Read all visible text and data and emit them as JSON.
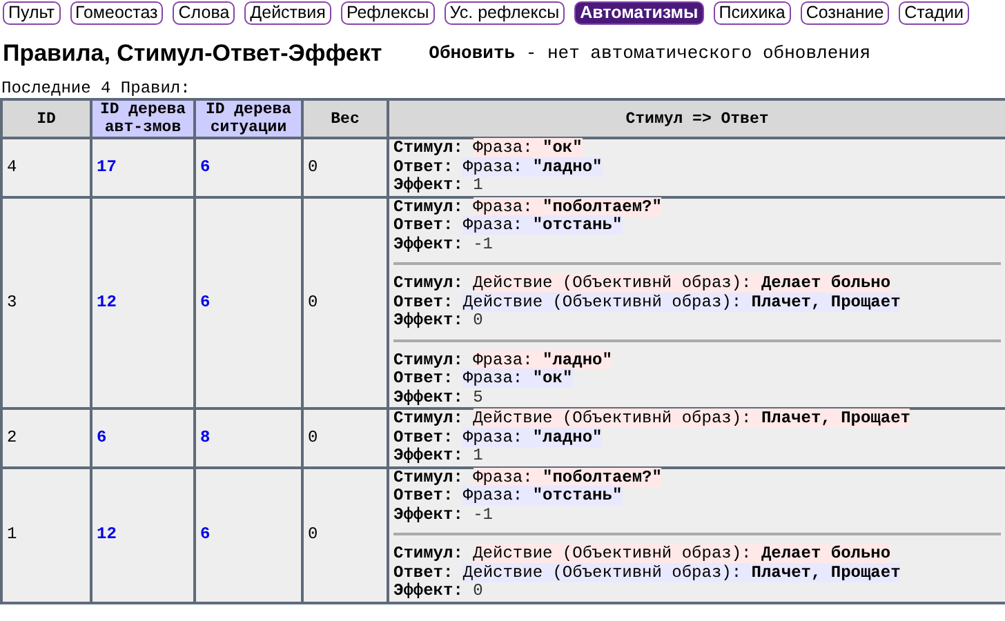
{
  "nav": [
    {
      "label": "Пульт",
      "selected": false
    },
    {
      "label": "Гомеостаз",
      "selected": false
    },
    {
      "label": "Слова",
      "selected": false
    },
    {
      "label": "Действия",
      "selected": false
    },
    {
      "label": "Рефлексы",
      "selected": false
    },
    {
      "label": "Ус. рефлексы",
      "selected": false
    },
    {
      "label": "Автоматизмы",
      "selected": true
    },
    {
      "label": "Психика",
      "selected": false
    },
    {
      "label": "Сознание",
      "selected": false
    },
    {
      "label": "Стадии",
      "selected": false
    }
  ],
  "title": "Правила, Стимул-Ответ-Эффект",
  "refresh_link": "Обновить",
  "refresh_note": " - нет автоматического обновления",
  "caption": "Последние 4 Правил:",
  "table": {
    "columns": [
      {
        "label": "ID",
        "kind": "plain"
      },
      {
        "label": "ID дерева авт-змов",
        "kind": "id"
      },
      {
        "label": "ID дерева ситуации",
        "kind": "id"
      },
      {
        "label": "Вес",
        "kind": "plain"
      },
      {
        "label": "Стимул => Ответ",
        "kind": "plain"
      }
    ],
    "rows": [
      {
        "id": "4",
        "tree_id": "17",
        "situation_id": "6",
        "weight": "0",
        "rules": [
          {
            "stimulus": {
              "label": "Стимул:",
              "type": "Фраза:",
              "value": "\"ок\""
            },
            "response": {
              "label": "Ответ:",
              "type": "Фраза:",
              "value": "\"ладно\""
            },
            "effect": {
              "label": "Эффект:",
              "value": "1"
            }
          }
        ]
      },
      {
        "id": "3",
        "tree_id": "12",
        "situation_id": "6",
        "weight": "0",
        "rules": [
          {
            "stimulus": {
              "label": "Стимул:",
              "type": "Фраза:",
              "value": "\"поболтаем?\""
            },
            "response": {
              "label": "Ответ:",
              "type": "Фраза:",
              "value": "\"отстань\""
            },
            "effect": {
              "label": "Эффект:",
              "value": "-1"
            }
          },
          {
            "stimulus": {
              "label": "Стимул:",
              "type": "Действие (Объективнй образ):",
              "value": "Делает больно"
            },
            "response": {
              "label": "Ответ:",
              "type": "Действие (Объективнй образ):",
              "value": "Плачет, Прощает"
            },
            "effect": {
              "label": "Эффект:",
              "value": "0"
            }
          },
          {
            "stimulus": {
              "label": "Стимул:",
              "type": "Фраза:",
              "value": "\"ладно\""
            },
            "response": {
              "label": "Ответ:",
              "type": "Фраза:",
              "value": "\"ок\""
            },
            "effect": {
              "label": "Эффект:",
              "value": "5"
            }
          }
        ]
      },
      {
        "id": "2",
        "tree_id": "6",
        "situation_id": "8",
        "weight": "0",
        "rules": [
          {
            "stimulus": {
              "label": "Стимул:",
              "type": "Действие (Объективнй образ):",
              "value": "Плачет, Прощает"
            },
            "response": {
              "label": "Ответ:",
              "type": "Фраза:",
              "value": "\"ладно\""
            },
            "effect": {
              "label": "Эффект:",
              "value": "1"
            }
          }
        ]
      },
      {
        "id": "1",
        "tree_id": "12",
        "situation_id": "6",
        "weight": "0",
        "rules": [
          {
            "stimulus": {
              "label": "Стимул:",
              "type": "Фраза:",
              "value": "\"поболтаем?\""
            },
            "response": {
              "label": "Ответ:",
              "type": "Фраза:",
              "value": "\"отстань\""
            },
            "effect": {
              "label": "Эффект:",
              "value": "-1"
            }
          },
          {
            "stimulus": {
              "label": "Стимул:",
              "type": "Действие (Объективнй образ):",
              "value": "Делает больно"
            },
            "response": {
              "label": "Ответ:",
              "type": "Действие (Объективнй образ):",
              "value": "Плачет, Прощает"
            },
            "effect": {
              "label": "Эффект:",
              "value": "0"
            }
          }
        ]
      }
    ]
  }
}
